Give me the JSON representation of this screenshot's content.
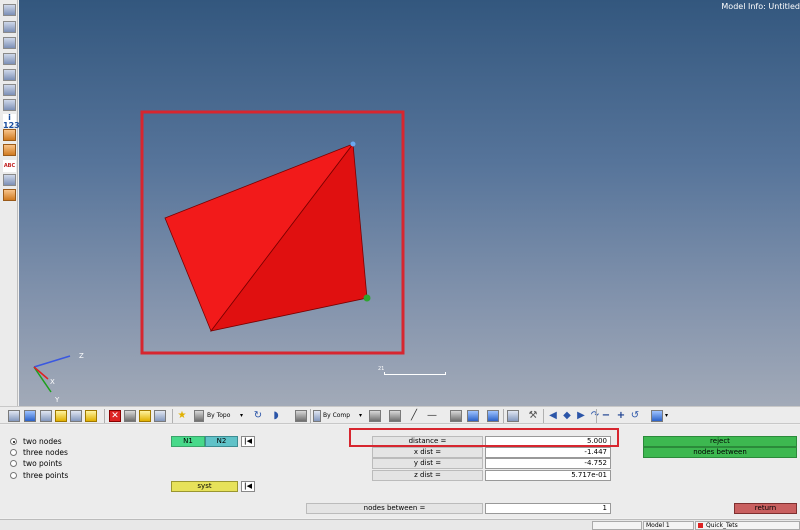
{
  "viewport": {
    "model_info": "Model Info: Untitled",
    "axis_labels": {
      "z": "Z",
      "x": "X",
      "y": "Y"
    },
    "scale_label": "21",
    "colors": {
      "part": "#ee1111",
      "highlight": "#d7262f",
      "node_n1": "#4a90e2",
      "node_n2": "#2fa52f"
    }
  },
  "left_toolbar": {
    "icons": [
      "measure-icon",
      "mesh-icon",
      "elements-icon",
      "layer-icon",
      "card-icon",
      "hide-icon",
      "binoculars-icon",
      "info-123-icon",
      "ruler-icon",
      "abc-note-icon",
      "abc-label-icon",
      "mesh-edit-icon",
      "grid-icon"
    ],
    "info_text": "i 123",
    "abc_text": "ABC"
  },
  "main_toolbar": {
    "by_topo": "By Topo",
    "by_comp": "By Comp"
  },
  "panel": {
    "radio_options": [
      {
        "label": "two nodes",
        "selected": true
      },
      {
        "label": "three nodes",
        "selected": false
      },
      {
        "label": "two points",
        "selected": false
      },
      {
        "label": "three points",
        "selected": false
      }
    ],
    "n1_label": "N1",
    "n2_label": "N2",
    "syst_label": "syst",
    "reset_glyph": "|◀",
    "fields": [
      {
        "label": "distance =",
        "value": "5.000"
      },
      {
        "label": "x dist  =",
        "value": "-1.447"
      },
      {
        "label": "y dist  =",
        "value": "-4.752"
      },
      {
        "label": "z dist  =",
        "value": "5.717e-01"
      }
    ],
    "nodes_between_label": "nodes between  =",
    "nodes_between_value": "1",
    "reject_label": "reject",
    "nodes_between_button": "nodes  between",
    "return_label": "return"
  },
  "status_bar": {
    "model": "Model 1",
    "collector": "Quick_Tets"
  }
}
